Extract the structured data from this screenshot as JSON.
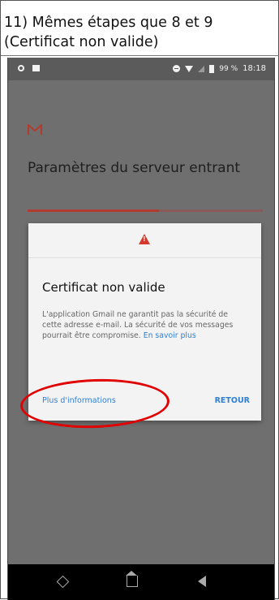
{
  "caption": {
    "line1": "11) Mêmes étapes que 8 et 9",
    "line2": "(Certificat non valide)"
  },
  "statusbar": {
    "battery": "99 %",
    "time": "18:18",
    "icons": [
      "notification-icon",
      "image-icon",
      "do-not-disturb-icon",
      "wifi-icon",
      "signal-icon",
      "battery-icon"
    ]
  },
  "app": {
    "logo": "gmail-icon",
    "title": "Paramètres du serveur entrant",
    "progress": 0.56,
    "accent": "#b23a2f"
  },
  "dialog": {
    "header_icon": "warning-icon",
    "title": "Certificat non valide",
    "body": "L'application Gmail ne garantit pas la sécurité de cette adresse e-mail. La sécurité de vos messages pourrait être compromise.",
    "link": "En savoir plus",
    "more_button": "Plus d'informations",
    "back_button": "RETOUR",
    "link_color": "#2f7fd3",
    "warning_color": "#d5392e"
  },
  "navbar": {
    "icons": [
      "recent-apps-icon",
      "home-icon",
      "back-icon"
    ]
  }
}
